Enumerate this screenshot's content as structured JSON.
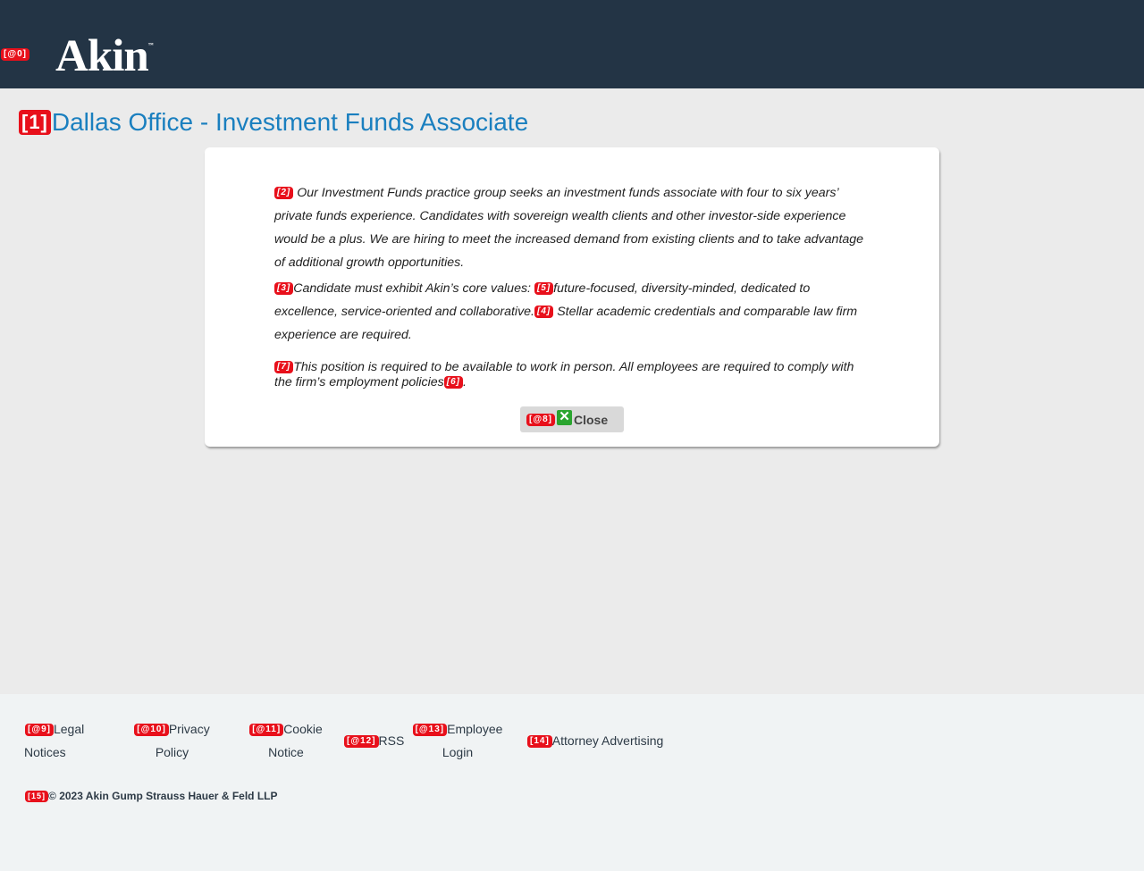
{
  "tags": {
    "logo": "[@0]",
    "title": "[1]",
    "p1": "[2]",
    "p2": "[3]",
    "p2_values": "[5]",
    "p2_req": "[4]",
    "p3": "[7]",
    "p3_policies": "[6]",
    "close": "[@8]",
    "legal": "[@9]",
    "privacy": "[@10]",
    "cookie": "[@11]",
    "rss": "[@12]",
    "employee": "[@13]",
    "attorney": "[14]",
    "copyright": "[15]"
  },
  "header": {
    "logo_text": "Akin",
    "logo_tm": "™"
  },
  "page": {
    "title": "Dallas Office - Investment Funds Associate"
  },
  "job": {
    "p1": "Our Investment Funds practice group seeks an investment funds associate with four to six years’ private funds experience.  Candidates with sovereign wealth clients and other investor-side experience would be a plus. We are hiring to meet the increased demand from existing clients and to take advantage of additional growth opportunities.",
    "p2_a": "Candidate must exhibit Akin’s core values: ",
    "p2_b": "future-focused, diversity-minded, dedicated to excellence, service-oriented and collaborative.",
    "p2_c": " Stellar academic credentials and comparable law firm experience are required.",
    "p3_a": "This position is required to be available to work in person. All employees are required to comply with the firm’s employment policies",
    "p3_b": "."
  },
  "close_button": {
    "label": "Close",
    "icon": "close-x-icon",
    "icon_glyph": "✕"
  },
  "footer": {
    "legal_1": "Legal",
    "legal_2": "Notices",
    "privacy_1": "Privacy",
    "privacy_2": "Policy",
    "cookie_1": "Cookie",
    "cookie_2": "Notice",
    "rss": "RSS",
    "employee_1": "Employee",
    "employee_2": "Login",
    "attorney": "Attorney Advertising",
    "copyright": "© 2023 Akin Gump Strauss Hauer & Feld LLP"
  },
  "colors": {
    "header_bg": "#233445",
    "title": "#1a7fbf",
    "tag": "#e8101b",
    "close_icon": "#2aa52f"
  }
}
